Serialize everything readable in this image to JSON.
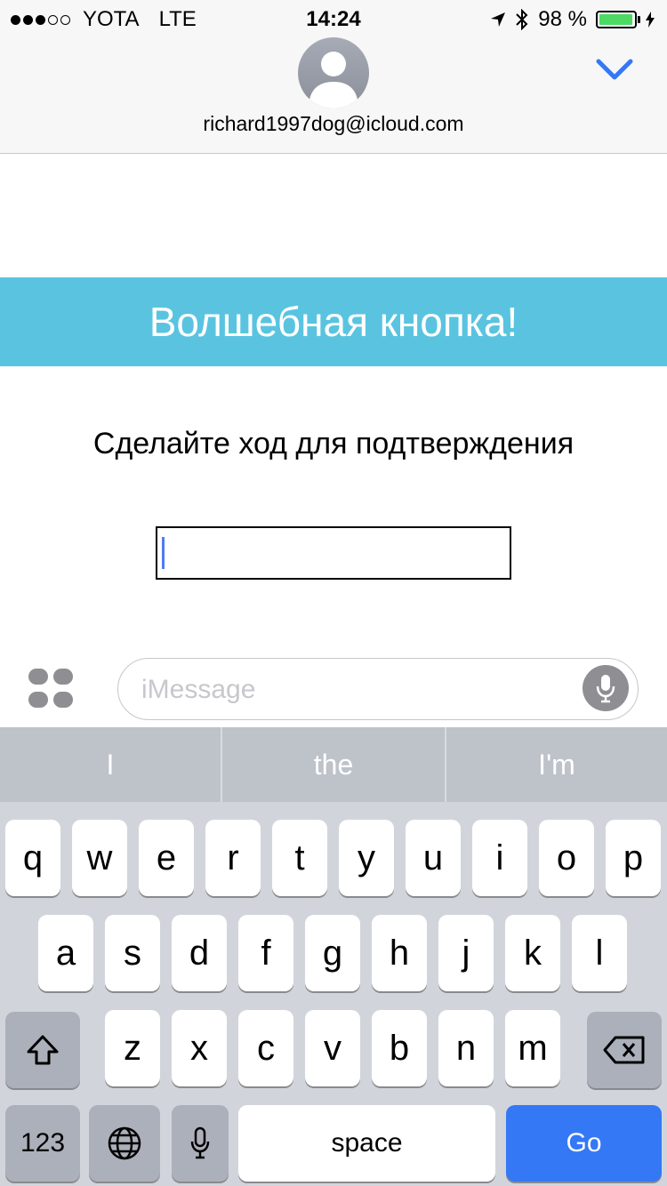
{
  "status_bar": {
    "carrier": "YOTA",
    "network": "LTE",
    "time": "14:24",
    "battery_text": "98 %",
    "battery_fraction": 0.98
  },
  "header": {
    "contact": "richard1997dog@icloud.com"
  },
  "content": {
    "banner": "Волшебная кнопка!",
    "prompt": "Сделайте ход для подтверждения",
    "input_value": ""
  },
  "compose": {
    "placeholder": "iMessage"
  },
  "keyboard": {
    "suggestions": [
      "I",
      "the",
      "I'm"
    ],
    "row1": [
      "q",
      "w",
      "e",
      "r",
      "t",
      "y",
      "u",
      "i",
      "o",
      "p"
    ],
    "row2": [
      "a",
      "s",
      "d",
      "f",
      "g",
      "h",
      "j",
      "k",
      "l"
    ],
    "row3": [
      "z",
      "x",
      "c",
      "v",
      "b",
      "n",
      "m"
    ],
    "numbers": "123",
    "space": "space",
    "go": "Go"
  },
  "colors": {
    "banner": "#5ac4e0",
    "go_key": "#3478f6",
    "accent": "#3478f6",
    "battery": "#4cd964"
  }
}
